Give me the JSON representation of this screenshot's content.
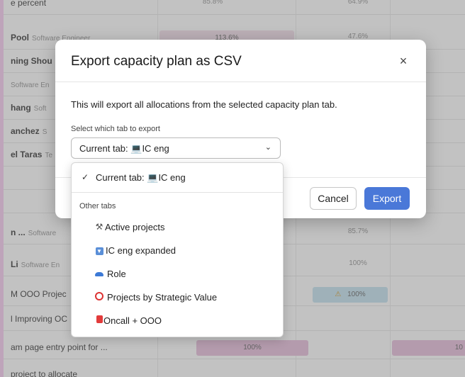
{
  "background": {
    "rows": [
      {
        "name": "e percent",
        "role": "",
        "v1": "85.8%",
        "v2": "64.9%"
      },
      {
        "name": "Pool",
        "role": "Software Engineer",
        "v1": "113.6%",
        "v2": "47.6%"
      },
      {
        "name": "ning Shou",
        "role": "",
        "v1": "",
        "v2": ""
      },
      {
        "name": "",
        "role": "Software En",
        "v1": "",
        "v2": ""
      },
      {
        "name": "hang",
        "role": "Soft",
        "v1": "",
        "v2": ""
      },
      {
        "name": "anchez",
        "role": "S",
        "v1": "",
        "v2": ""
      },
      {
        "name": "el Taras",
        "role": "Te",
        "v1": "",
        "v2": ""
      },
      {
        "name": "n ...",
        "role": "Software",
        "v1": "",
        "v2": "85.7%"
      },
      {
        "name": "Li",
        "role": "Software En",
        "v1": "",
        "v2": "100%"
      },
      {
        "name": "M OOO Projec",
        "role": "",
        "v1": "",
        "v2": "100%"
      },
      {
        "name": "l Improving OC",
        "role": "",
        "v1": "",
        "v2": ""
      },
      {
        "name": "am page entry point for ...",
        "role": "",
        "v1": "100%",
        "v2": "10"
      },
      {
        "name": "project to allocate",
        "role": "",
        "v1": "",
        "v2": ""
      }
    ],
    "warning_icon": "warning-icon"
  },
  "modal": {
    "title": "Export capacity plan as CSV",
    "close_icon": "×",
    "description": "This will export all allocations from the selected capacity plan tab.",
    "select_label": "Select which tab to export",
    "select_value": "Current tab: 💻IC eng",
    "cancel_label": "Cancel",
    "export_label": "Export"
  },
  "dropdown": {
    "current_label": "Current tab: 💻IC eng",
    "group_label": "Other tabs",
    "items": [
      {
        "icon": "hammer-icon",
        "label": "Active projects"
      },
      {
        "icon": "expand-icon",
        "label": "IC eng expanded"
      },
      {
        "icon": "cap-icon",
        "label": "Role"
      },
      {
        "icon": "target-icon",
        "label": "Projects by Strategic Value"
      },
      {
        "icon": "alarm-icon",
        "label": "Oncall + OOO"
      }
    ]
  },
  "colors": {
    "accent": "#4a78d8",
    "page_bg": "#f8c8f0",
    "bar_pink": "#e6b8d9",
    "bar_blue": "#bfe0ef"
  }
}
